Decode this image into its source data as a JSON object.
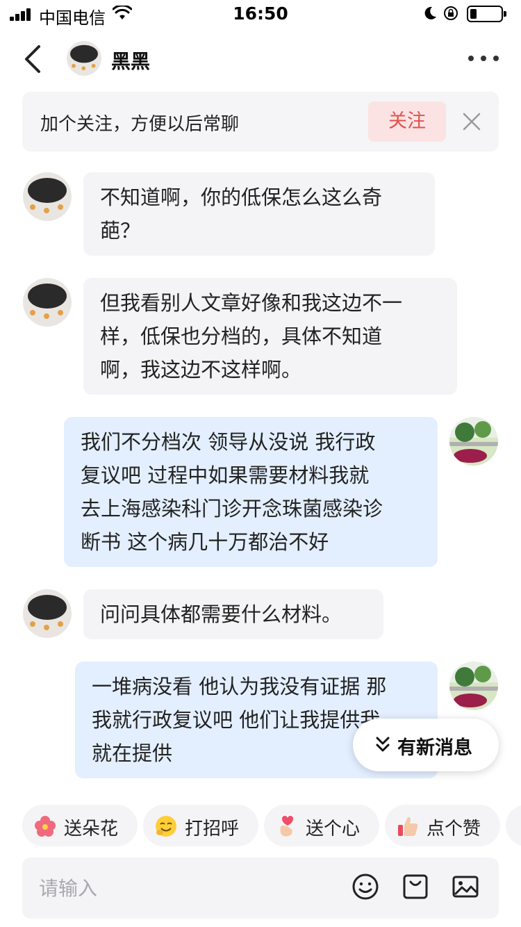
{
  "status_bar": {
    "carrier": "中国电信",
    "time": "16:50",
    "battery_level": 0.22
  },
  "header": {
    "contact_name": "黑黑",
    "back_icon": "chevron-left-icon",
    "more_icon": "more-horizontal-icon"
  },
  "follow_banner": {
    "text": "加个关注，方便以后常聊",
    "button_label": "关注",
    "button_color": "#e2504e",
    "close_icon": "close-icon"
  },
  "messages": [
    {
      "side": "left",
      "text": "不知道啊，你的低保怎么这么奇葩？"
    },
    {
      "side": "left",
      "text": "但我看别人文章好像和我这边不一样，低保也分档的，具体不知道啊，我这边不这样啊。"
    },
    {
      "side": "right",
      "text": "我们不分档次 领导从没说 我行政复议吧 过程中如果需要材料我就去上海感染科门诊开念珠菌感染诊断书 这个病几十万都治不好"
    },
    {
      "side": "left",
      "text": "问问具体都需要什么材料。"
    },
    {
      "side": "right",
      "text": "一堆病没看 他认为我没有证据 那我就行政复议吧 他们让我提供我就在提供"
    }
  ],
  "message_lines": [
    [
      "不知道啊，你的低保怎么这么奇",
      "葩？"
    ],
    [
      "但我看别人文章好像和我这边不一",
      "样，低保也分档的，具体不知道",
      "啊，我这边不这样啊。"
    ],
    [
      "我们不分档次 领导从没说 我行政",
      "复议吧 过程中如果需要材料我就",
      "去上海感染科门诊开念珠菌感染诊",
      "断书 这个病几十万都治不好"
    ],
    [
      "问问具体都需要什么材料。"
    ],
    [
      "一堆病没看 他认为我没有证据 那",
      "我就行政复议吧 他们让我提供我",
      "就在提供"
    ]
  ],
  "new_message_pill": {
    "label": "有新消息",
    "icon": "double-chevron-down-icon"
  },
  "quick_replies": [
    {
      "label": "送朵花",
      "icon": "flower-icon"
    },
    {
      "label": "打招呼",
      "icon": "smile-emoji-icon"
    },
    {
      "label": "送个心",
      "icon": "finger-heart-icon"
    },
    {
      "label": "点个赞",
      "icon": "thumbs-up-icon"
    }
  ],
  "input_bar": {
    "placeholder": "请输入",
    "emoji_icon": "emoji-icon",
    "gift_icon": "shopping-bag-icon",
    "image_icon": "image-icon"
  },
  "colors": {
    "left_bubble": "#f4f4f6",
    "right_bubble": "#e3efff",
    "accent": "#e2504e"
  }
}
